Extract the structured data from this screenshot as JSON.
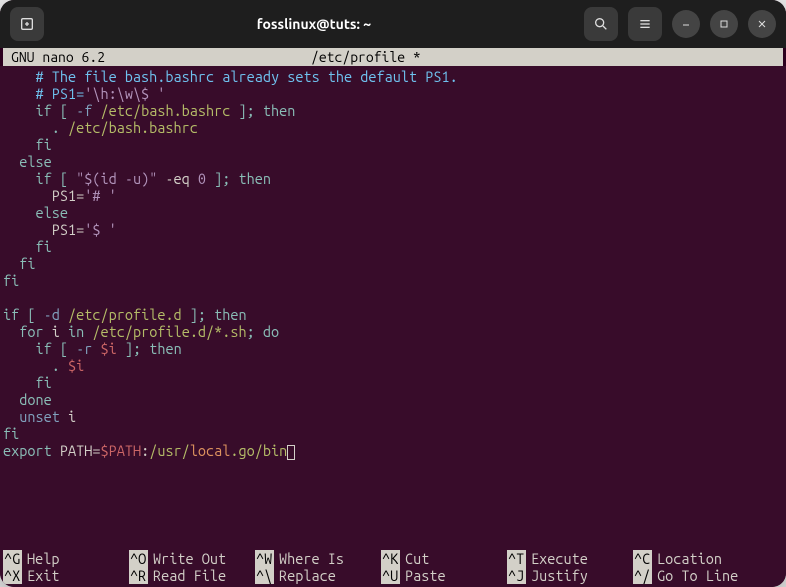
{
  "titlebar": {
    "title": "fosslinux@tuts: ~"
  },
  "nano": {
    "app": "  GNU nano 6.2",
    "file": "/etc/profile *"
  },
  "code": {
    "l1_indent": "    ",
    "l1_comment": "# The file bash.bashrc already sets the default PS1.",
    "l2_indent": "    ",
    "l2_hash": "# ",
    "l2_ps1": "PS1=",
    "l2_str": "'\\h:\\w\\$ '",
    "l3_indent": "    ",
    "l3_if": "if",
    "l3_lb": " [ ",
    "l3_flag": "-f ",
    "l3_path": "/etc/bash.bashrc",
    "l3_rb": " ];",
    "l3_then": " then",
    "l4_indent": "      ",
    "l4_dot": ".",
    "l4_path": " /etc/bash.bashrc",
    "l5_indent": "    ",
    "l5_fi": "fi",
    "l6_indent": "  ",
    "l6_else": "else",
    "l7_indent": "    ",
    "l7_if": "if",
    "l7_lb": " [ ",
    "l7_str": "\"$(id -u)\"",
    "l7_eq": " -eq ",
    "l7_zero": "0",
    "l7_rb": " ];",
    "l7_then": " then",
    "l8_indent": "      ",
    "l8_ps1": "PS1=",
    "l8_str": "'# '",
    "l9_indent": "    ",
    "l9_else": "else",
    "l10_indent": "      ",
    "l10_ps1": "PS1=",
    "l10_str": "'$ '",
    "l11_indent": "    ",
    "l11_fi": "fi",
    "l12_indent": "  ",
    "l12_fi": "fi",
    "l13_fi": "fi",
    "l14": "",
    "l15_if": "if",
    "l15_lb": " [ ",
    "l15_flag": "-d ",
    "l15_path": "/etc/profile.d",
    "l15_rb": " ];",
    "l15_then": " then",
    "l16_indent": "  ",
    "l16_for": "for",
    "l16_i": " i ",
    "l16_in": "in ",
    "l16_path": "/etc/profile.d/*.sh",
    "l16_do": "; do",
    "l17_indent": "    ",
    "l17_if": "if",
    "l17_lb": " [ ",
    "l17_flag": "-r ",
    "l17_var": "$i",
    "l17_rb": " ];",
    "l17_then": " then",
    "l18_indent": "      ",
    "l18_dot": ".",
    "l18_sp": " ",
    "l18_var": "$i",
    "l19_indent": "    ",
    "l19_fi": "fi",
    "l20_indent": "  ",
    "l20_done": "done",
    "l21_indent": "  ",
    "l21_unset": "unset",
    "l21_i": " i",
    "l22_fi": "fi",
    "l23_export": "export",
    "l23_path": " PATH=",
    "l23_var": "$PATH",
    "l23_colon": ":",
    "l23_usr": "/usr/",
    "l23_local": "local",
    "l23_go": ".go/bin"
  },
  "help": {
    "r1": [
      {
        "key": "^G",
        "label": "Help"
      },
      {
        "key": "^O",
        "label": "Write Out"
      },
      {
        "key": "^W",
        "label": "Where Is"
      },
      {
        "key": "^K",
        "label": "Cut"
      },
      {
        "key": "^T",
        "label": "Execute"
      },
      {
        "key": "^C",
        "label": "Location"
      }
    ],
    "r2": [
      {
        "key": "^X",
        "label": "Exit"
      },
      {
        "key": "^R",
        "label": "Read File"
      },
      {
        "key": "^\\",
        "label": "Replace"
      },
      {
        "key": "^U",
        "label": "Paste"
      },
      {
        "key": "^J",
        "label": "Justify"
      },
      {
        "key": "^/",
        "label": "Go To Line"
      }
    ]
  }
}
